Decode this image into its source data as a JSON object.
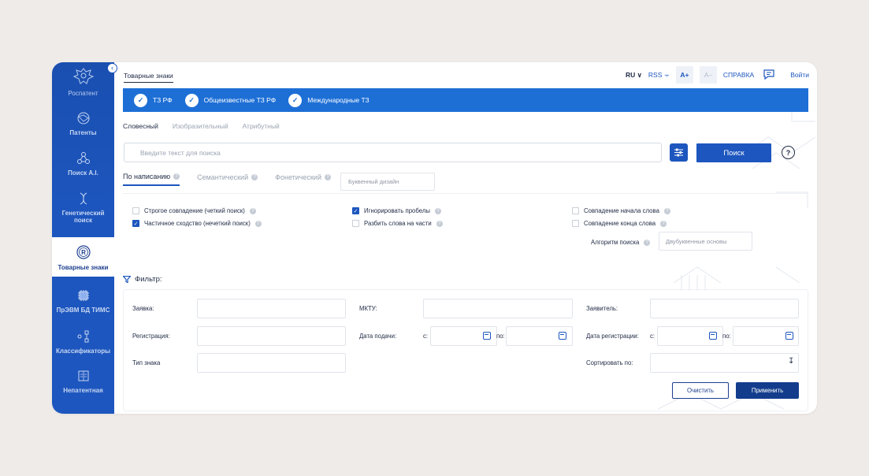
{
  "sidebar": {
    "brand": "Роспатент",
    "items": [
      {
        "label": "Патенты"
      },
      {
        "label": "Поиск A.I."
      },
      {
        "label": "Генетический поиск"
      },
      {
        "label": "Товарные знаки"
      },
      {
        "label": "ПрЭВМ БД ТИМС"
      },
      {
        "label": "Классификаторы"
      },
      {
        "label": "Непатентная"
      }
    ]
  },
  "header": {
    "breadcrumb": "Товарные знаки",
    "lang": "RU",
    "rss": "RSS",
    "font_increase": "A+",
    "font_decrease": "A–",
    "help": "СПРАВКА",
    "login": "Войти"
  },
  "databases": [
    {
      "label": "ТЗ РФ",
      "checked": true
    },
    {
      "label": "Общеизвестные ТЗ РФ",
      "checked": true
    },
    {
      "label": "Международные ТЗ",
      "checked": true
    }
  ],
  "search_modes": {
    "verbal": "Словесный",
    "figurative": "Изобразительный",
    "attribute": "Атрибутный"
  },
  "search": {
    "placeholder": "Введите текст для поиска",
    "button": "Поиск",
    "help": "?"
  },
  "sub_tabs": {
    "spelling": "По написанию",
    "semantic": "Семантический",
    "phonetic": "Фонетический",
    "letter_design_placeholder": "Буквенный дизайн"
  },
  "options": {
    "strict": {
      "label": "Строгое совпадение (четкий поиск)",
      "checked": false
    },
    "partial": {
      "label": "Частичное сходство (нечеткий поиск)",
      "checked": true
    },
    "ignore_spaces": {
      "label": "Игнорировать пробелы",
      "checked": true
    },
    "split_words": {
      "label": "Разбить слова на части",
      "checked": false
    },
    "word_start": {
      "label": "Совпадение начала слова",
      "checked": false
    },
    "word_end": {
      "label": "Совпадение конца слова",
      "checked": false
    },
    "algorithm_label": "Алгоритм поиска",
    "algorithm_placeholder": "Двубуквенные основы"
  },
  "filter": {
    "title": "Фильтр:",
    "application": "Заявка:",
    "registration": "Регистрация:",
    "mark_type": "Тип знака",
    "mktu": "МКТУ:",
    "filing_date": "Дата подачи:",
    "applicant": "Заявитель:",
    "registration_date": "Дата регистрации:",
    "sort_by": "Сортировать по:",
    "from": "с:",
    "to": "по:",
    "clear": "Очистить",
    "apply": "Применить"
  },
  "colors": {
    "sidebar": "#1d56be",
    "band": "#1d6fd6",
    "primary": "#1d56be",
    "apply": "#133d8c"
  }
}
